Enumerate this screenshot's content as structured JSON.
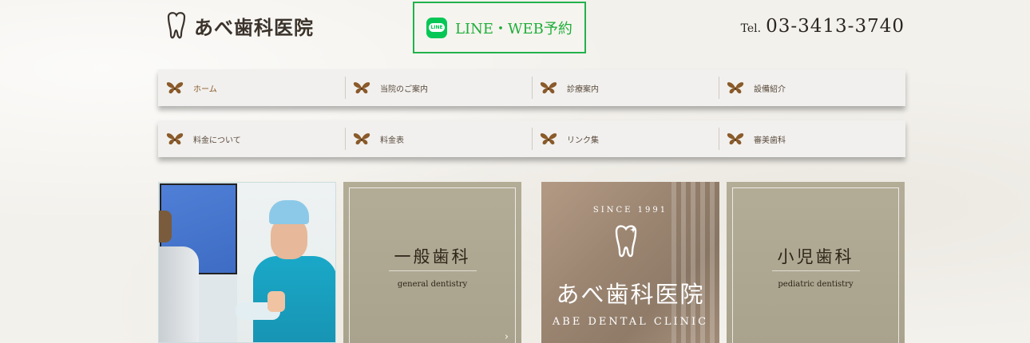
{
  "header": {
    "logo_text": "あべ歯科医院",
    "line_button_label": "LINE・WEB予約",
    "line_icon_text": "LINE",
    "tel_prefix": "Tel.",
    "tel_number": "03-3413-3740"
  },
  "nav": {
    "row1": [
      {
        "label": "ホーム"
      },
      {
        "label": "当院のご案内"
      },
      {
        "label": "診療案内"
      },
      {
        "label": "設備紹介"
      }
    ],
    "row2": [
      {
        "label": "料金について"
      },
      {
        "label": "料金表"
      },
      {
        "label": "リンク集"
      },
      {
        "label": "審美歯科"
      }
    ]
  },
  "tiles": {
    "general": {
      "title": "一般歯科",
      "subtitle": "general dentistry"
    },
    "brand": {
      "since": "SINCE 1991",
      "name_jp": "あべ歯科医院",
      "name_en": "ABE DENTAL CLINIC"
    },
    "pediatric": {
      "title": "小児歯科",
      "subtitle": "pediatric dentistry"
    }
  },
  "colors": {
    "line_green": "#06c755",
    "tile_beige": "#b3ad97",
    "butterfly": "#8a5a2a"
  },
  "icons": {
    "nav": "butterfly-icon",
    "logo": "tooth-icon",
    "arrow": "chevron-right-icon"
  }
}
